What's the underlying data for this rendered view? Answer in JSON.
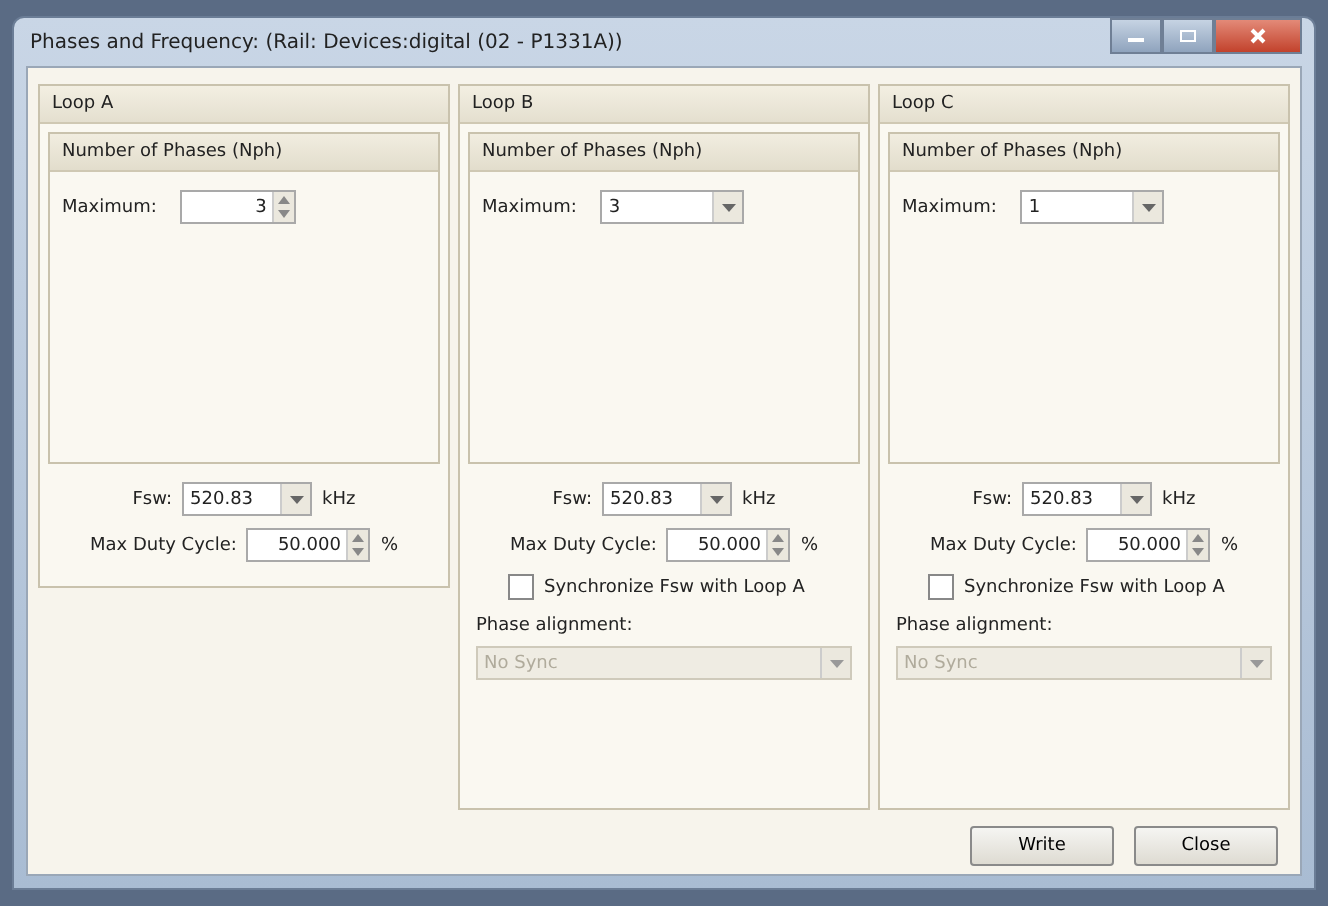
{
  "window": {
    "title": "Phases and Frequency: (Rail: Devices:digital (02  - P1331A))"
  },
  "loops": [
    {
      "title": "Loop A",
      "group_title": "Number of Phases (Nph)",
      "maximum": {
        "label": "Maximum:",
        "value": "3",
        "kind": "spinner"
      },
      "fsw": {
        "label": "Fsw:",
        "value": "520.83",
        "unit": "kHz"
      },
      "duty": {
        "label": "Max Duty Cycle:",
        "value": "50.000",
        "unit": "%"
      }
    },
    {
      "title": "Loop B",
      "group_title": "Number of Phases (Nph)",
      "maximum": {
        "label": "Maximum:",
        "value": "3",
        "kind": "dropdown"
      },
      "fsw": {
        "label": "Fsw:",
        "value": "520.83",
        "unit": "kHz"
      },
      "duty": {
        "label": "Max Duty Cycle:",
        "value": "50.000",
        "unit": "%"
      },
      "sync": {
        "label": "Synchronize Fsw with Loop A",
        "checked": false
      },
      "alignment": {
        "label": "Phase alignment:",
        "value": "No Sync",
        "disabled": true
      }
    },
    {
      "title": "Loop C",
      "group_title": "Number of Phases (Nph)",
      "maximum": {
        "label": "Maximum:",
        "value": "1",
        "kind": "dropdown"
      },
      "fsw": {
        "label": "Fsw:",
        "value": "520.83",
        "unit": "kHz"
      },
      "duty": {
        "label": "Max Duty Cycle:",
        "value": "50.000",
        "unit": "%"
      },
      "sync": {
        "label": "Synchronize Fsw with Loop A",
        "checked": false
      },
      "alignment": {
        "label": "Phase alignment:",
        "value": "No Sync",
        "disabled": true
      }
    }
  ],
  "buttons": [
    "Write",
    "Close"
  ]
}
